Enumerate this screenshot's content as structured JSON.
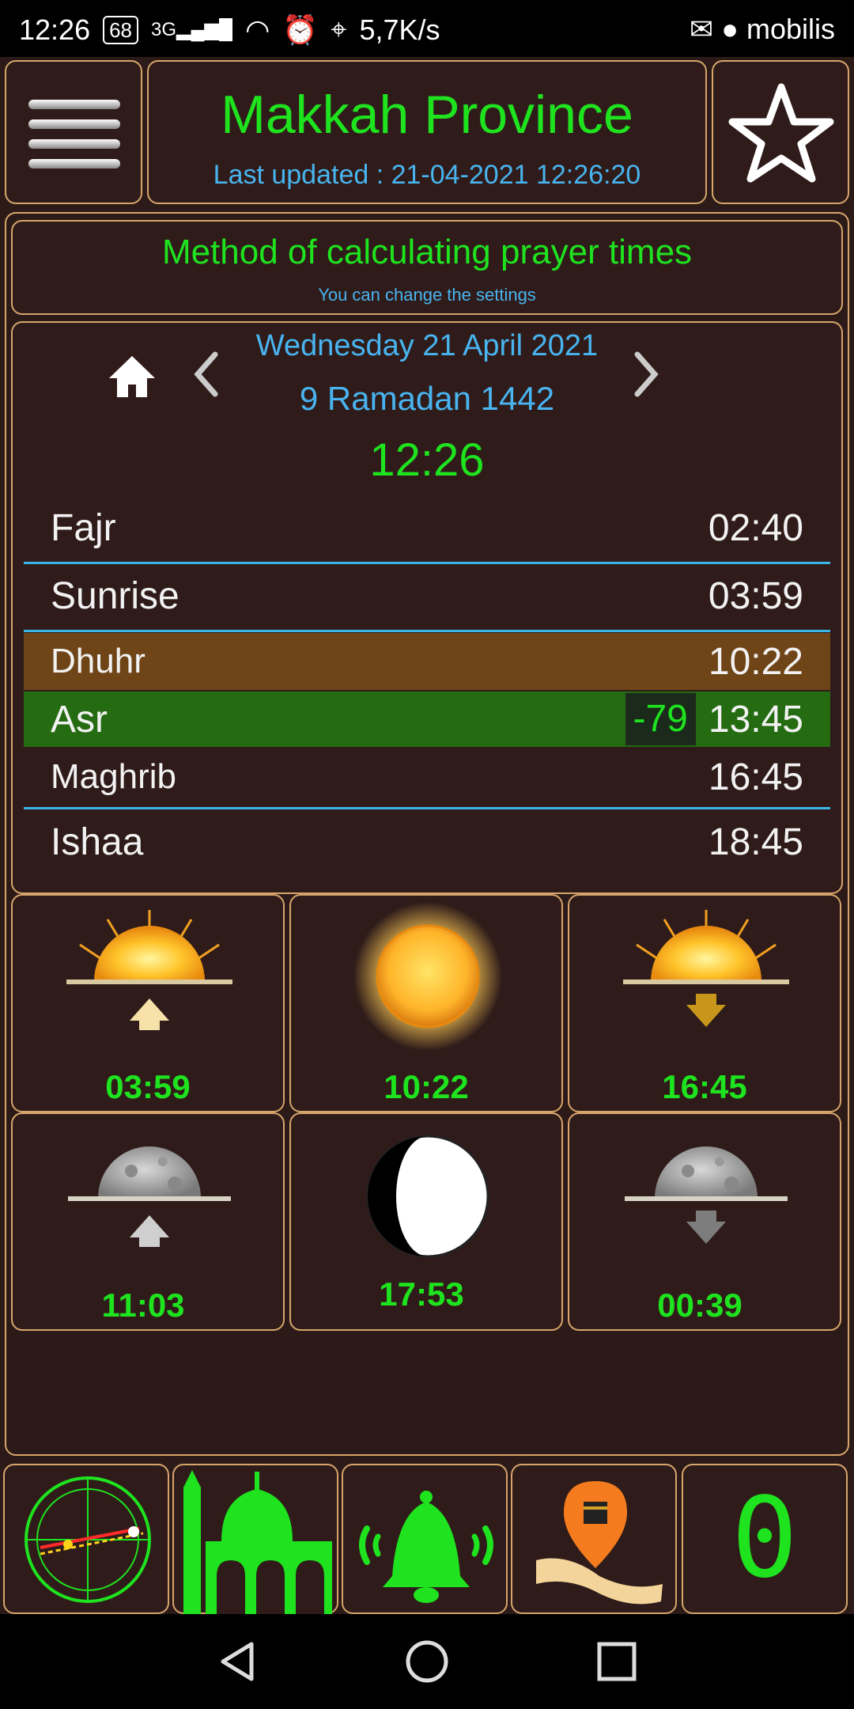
{
  "status_bar": {
    "time": "12:26",
    "battery": "68",
    "network_type": "3G",
    "data_rate": "5,7K/s",
    "carrier": "mobilis"
  },
  "header": {
    "location": "Makkah Province",
    "last_updated": "Last updated : 21-04-2021 12:26:20"
  },
  "method": {
    "title": "Method of calculating prayer times",
    "subtitle": "You can change the settings"
  },
  "date": {
    "gregorian": "Wednesday 21 April 2021",
    "hijri": "9 Ramadan 1442",
    "current_time": "12:26"
  },
  "prayers": [
    {
      "name": "Fajr",
      "time": "02:40"
    },
    {
      "name": "Sunrise",
      "time": "03:59"
    },
    {
      "name": "Dhuhr",
      "time": "10:22"
    },
    {
      "name": "Asr",
      "time": "13:45",
      "countdown": "-79"
    },
    {
      "name": "Maghrib",
      "time": "16:45"
    },
    {
      "name": "Ishaa",
      "time": "18:45"
    }
  ],
  "astro": {
    "sunrise": "03:59",
    "solar_noon": "10:22",
    "sunset": "16:45",
    "moonrise": "11:03",
    "moon_phase": "17:53",
    "moonset": "00:39"
  },
  "bottom_nav": {
    "counter": "0"
  },
  "colors": {
    "accent_green": "#1ee31e",
    "accent_blue": "#48b4f0",
    "border_gold": "#d7a56b",
    "dhuhr_row": "#6f4518",
    "asr_row": "#256b12"
  }
}
